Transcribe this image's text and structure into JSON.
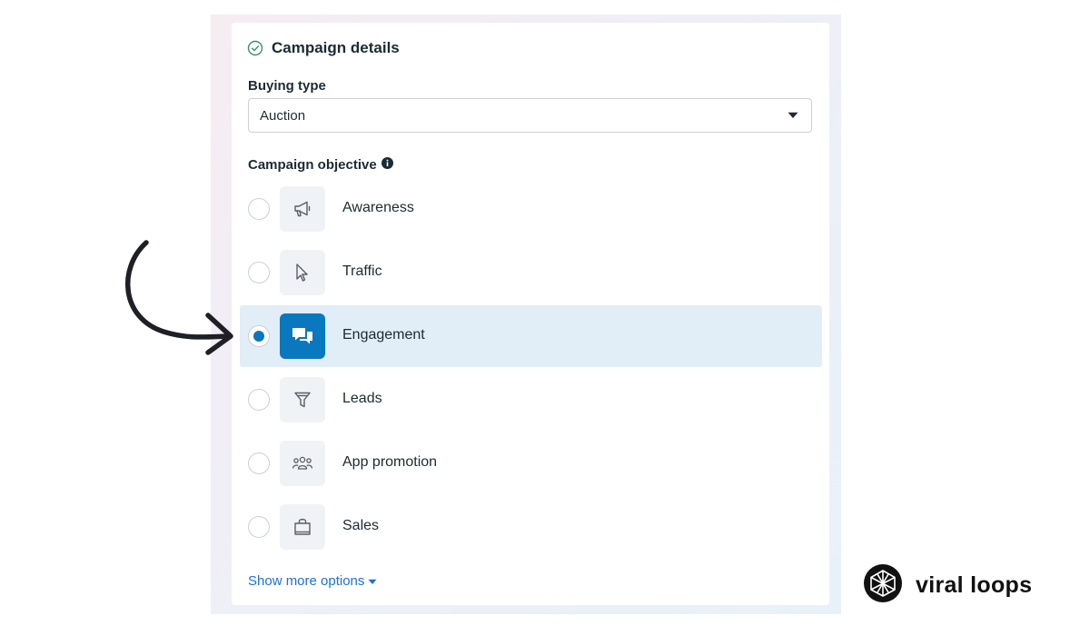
{
  "panel": {
    "title": "Campaign details",
    "buying_type": {
      "label": "Buying type",
      "value": "Auction"
    },
    "objective": {
      "label": "Campaign objective",
      "options": [
        {
          "label": "Awareness",
          "icon": "megaphone-icon",
          "selected": false
        },
        {
          "label": "Traffic",
          "icon": "cursor-icon",
          "selected": false
        },
        {
          "label": "Engagement",
          "icon": "chat-bubbles-icon",
          "selected": true
        },
        {
          "label": "Leads",
          "icon": "funnel-icon",
          "selected": false
        },
        {
          "label": "App promotion",
          "icon": "people-icon",
          "selected": false
        },
        {
          "label": "Sales",
          "icon": "shopping-bag-icon",
          "selected": false
        }
      ]
    },
    "show_more": "Show more options"
  },
  "brand": {
    "name": "viral loops"
  },
  "colors": {
    "accent": "#0a78be",
    "selected_bg": "#e1edf7",
    "link": "#216fdb",
    "check": "#2e8b57"
  }
}
